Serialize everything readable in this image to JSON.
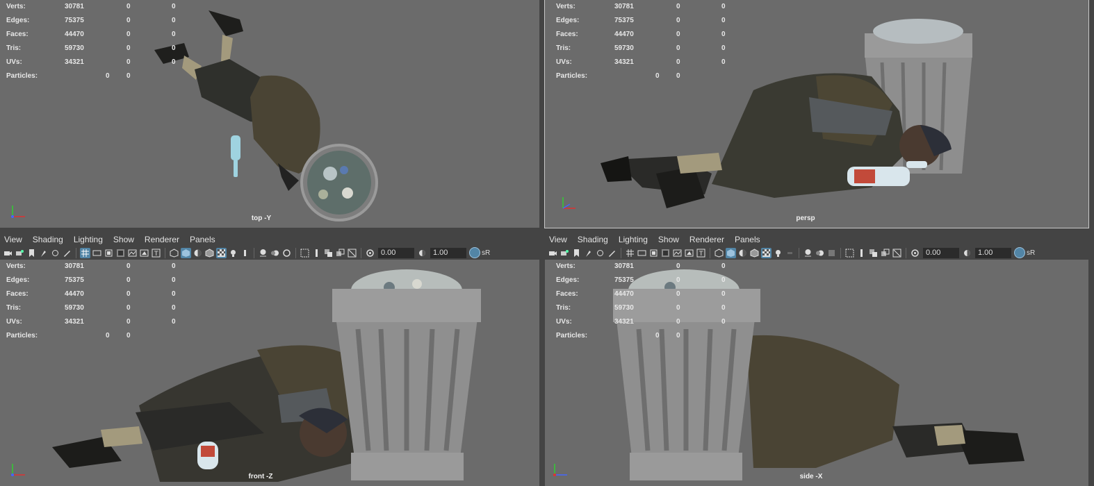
{
  "hud": {
    "rows": [
      {
        "label": "Verts:",
        "v1": "30781",
        "v2": "0",
        "v3": "0"
      },
      {
        "label": "Edges:",
        "v1": "75375",
        "v2": "0",
        "v3": "0"
      },
      {
        "label": "Faces:",
        "v1": "44470",
        "v2": "0",
        "v3": "0"
      },
      {
        "label": "Tris:",
        "v1": "59730",
        "v2": "0",
        "v3": "0"
      },
      {
        "label": "UVs:",
        "v1": "34321",
        "v2": "0",
        "v3": "0"
      }
    ],
    "particles": {
      "label": "Particles:",
      "v1": "0",
      "v2": "0"
    }
  },
  "viewports": {
    "top": {
      "camera": "top -Y"
    },
    "persp": {
      "camera": "persp"
    },
    "front": {
      "camera": "front -Z"
    },
    "side": {
      "camera": "side -X"
    }
  },
  "menu": {
    "items": [
      "View",
      "Shading",
      "Lighting",
      "Show",
      "Renderer",
      "Panels"
    ]
  },
  "toolbar": {
    "value_a": "0.00",
    "value_b": "1.00",
    "trailing": "sR"
  },
  "icons": [
    "camera-icon",
    "grid-icon",
    "wireframe-icon",
    "smooth-shade-icon",
    "texture-icon",
    "isolate-icon",
    "exposure-icon",
    "gamma-icon"
  ],
  "colors": {
    "viewport_bg": "#6b6b6b",
    "panel_bg": "#444444",
    "highlight": "#5285a6",
    "axis_x": "#d33",
    "axis_y": "#3c3",
    "axis_z": "#46f"
  }
}
